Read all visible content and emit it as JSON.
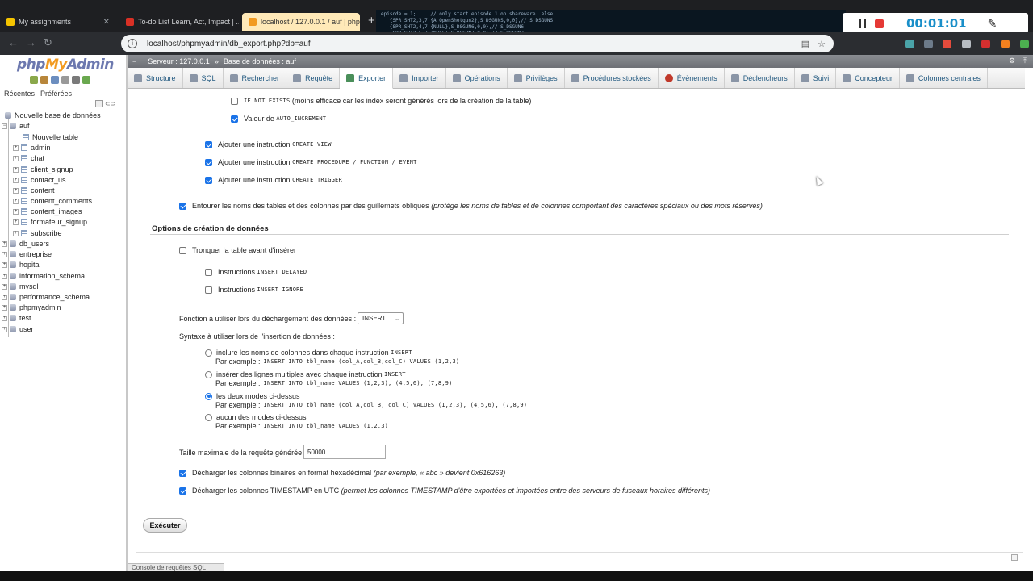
{
  "browser": {
    "tabs": [
      {
        "label": "My assignments",
        "color": "#f5c400"
      },
      {
        "label": "To-do List Learn, Act, Impact | ...",
        "color": "#d93025"
      },
      {
        "label": "localhost / 127.0.0.1 / auf | php...",
        "color": "#f29a20"
      }
    ],
    "new_tab": "+",
    "url": "localhost/phpmyadmin/db_export.php?db=auf",
    "code_overlay": "episode = 1;     // only start episode 1 on shareware  else\n   {SPR_SHT2,3,7,{A_OpenShotgun2},S_DSGUNS,0,0},// S_DSGUNS\n   {SPR_SHT2,4,7,{NULL},S_DSGUN6,0,0},// S_DSGUN6\n   {SPR_SHT2,5,7,{NULL},S_DSGUN7,0,0},// S_DSGUN7"
  },
  "recorder": {
    "time": "00:01:01"
  },
  "sidebar": {
    "logo": {
      "php": "php",
      "my": "My",
      "admin": "Admin"
    },
    "recents": "Récentes",
    "favorites": "Préférées",
    "new_db": "Nouvelle base de données",
    "current_db": "auf",
    "new_table": "Nouvelle table",
    "tables": [
      "admin",
      "chat",
      "client_signup",
      "contact_us",
      "content",
      "content_comments",
      "content_images",
      "formateur_signup",
      "subscribe"
    ],
    "databases": [
      "db_users",
      "entreprise",
      "hopital",
      "information_schema",
      "mysql",
      "performance_schema",
      "phpmyadmin",
      "test",
      "user"
    ]
  },
  "breadcrumb": {
    "server": "Serveur : 127.0.0.1",
    "sep": "»",
    "database": "Base de données : auf"
  },
  "menu": {
    "tabs": [
      "Structure",
      "SQL",
      "Rechercher",
      "Requête",
      "Exporter",
      "Importer",
      "Opérations",
      "Privilèges",
      "Procédures stockées",
      "Évènements",
      "Déclencheurs",
      "Suivi",
      "Concepteur",
      "Colonnes centrales"
    ],
    "active": "Exporter"
  },
  "options": {
    "if_not_exists_code": "IF NOT EXISTS",
    "if_not_exists_text": "(moins efficace car les index seront générés lors de la création de la table)",
    "auto_increment_label": "Valeur de",
    "auto_increment_code": "AUTO_INCREMENT",
    "add_instruction": "Ajouter une instruction",
    "create_view": "CREATE VIEW",
    "create_procedure": "CREATE PROCEDURE / FUNCTION / EVENT",
    "create_trigger": "CREATE TRIGGER",
    "backquotes_label": "Entourer les noms des tables et des colonnes par des guillemets obliques",
    "backquotes_hint": "(protège les noms de tables et de colonnes comportant des caractères spéciaux ou des mots réservés)",
    "data_section_title": "Options de création de données",
    "truncate_label": "Tronquer la table avant d'insérer",
    "instructions": "Instructions",
    "insert_delayed": "INSERT DELAYED",
    "insert_ignore": "INSERT IGNORE",
    "function_label": "Fonction à utiliser lors du déchargement des données :",
    "function_value": "INSERT",
    "syntax_label": "Syntaxe à utiliser lors de l'insertion de données :",
    "syntax_options": [
      {
        "label": "inclure les noms de colonnes dans chaque instruction",
        "code": "INSERT",
        "example_label": "Par exemple :",
        "example": "INSERT INTO tbl_name (col_A,col_B,col_C) VALUES (1,2,3)",
        "selected": false
      },
      {
        "label": "insérer des lignes multiples avec chaque instruction",
        "code": "INSERT",
        "example_label": "Par exemple :",
        "example": "INSERT INTO tbl_name VALUES (1,2,3), (4,5,6), (7,8,9)",
        "selected": false
      },
      {
        "label": "les deux modes ci-dessus",
        "code": "",
        "example_label": "Par exemple :",
        "example": "INSERT INTO tbl_name (col_A,col_B, col_C) VALUES (1,2,3), (4,5,6), (7,8,9)",
        "selected": true
      },
      {
        "label": "aucun des modes ci-dessus",
        "code": "",
        "example_label": "Par exemple :",
        "example": "INSERT INTO tbl_name VALUES (1,2,3)",
        "selected": false
      }
    ],
    "max_query_label": "Taille maximale de la requête générée",
    "max_query_value": "50000",
    "hex_label": "Décharger les colonnes binaires en format hexadécimal",
    "hex_hint": "(par exemple, « abc » devient 0x616263)",
    "utc_label": "Décharger les colonnes TIMESTAMP en UTC",
    "utc_hint": "(permet les colonnes TIMESTAMP d'être exportées et importées entre des serveurs de fuseaux horaires différents)"
  },
  "execute_label": "Exécuter",
  "sql_console": "Console de requêtes SQL"
}
